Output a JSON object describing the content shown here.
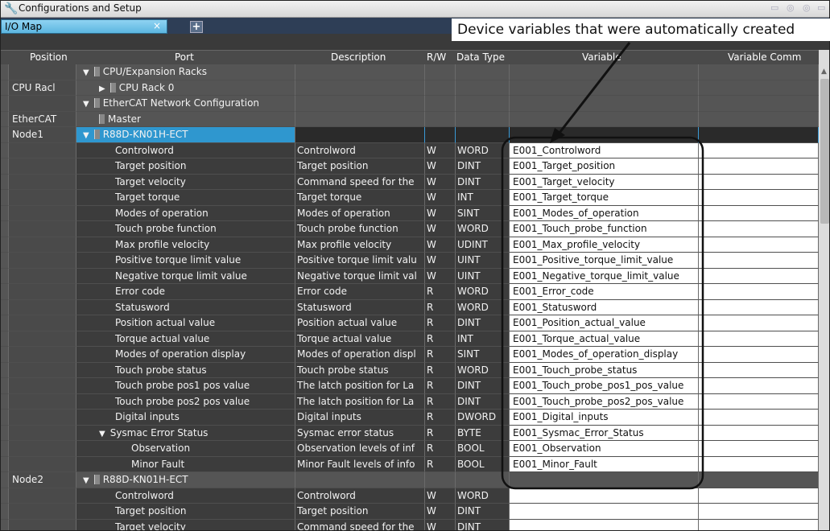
{
  "window": {
    "title": "Configurations and Setup"
  },
  "tab": {
    "label": "I/O Map",
    "close": "×",
    "add": "+"
  },
  "callout": "Device variables that were automatically created",
  "columns": [
    "Position",
    "Port",
    "Description",
    "R/W",
    "Data Type",
    "Variable",
    "Variable Comm"
  ],
  "rows": [
    {
      "pos": "",
      "indent": 0,
      "exp": "▼",
      "icon": "rack",
      "port": "CPU/Expansion Racks",
      "desc": "",
      "rw": "",
      "type": "",
      "var": "",
      "kind": "group"
    },
    {
      "pos": "CPU Racl",
      "indent": 1,
      "exp": "▶",
      "icon": "rack",
      "port": "CPU Rack 0",
      "desc": "",
      "rw": "",
      "type": "",
      "var": "",
      "kind": "group"
    },
    {
      "pos": "",
      "indent": 0,
      "exp": "▼",
      "icon": "net",
      "port": "EtherCAT Network Configuration",
      "desc": "",
      "rw": "",
      "type": "",
      "var": "",
      "kind": "group"
    },
    {
      "pos": "EtherCAT",
      "indent": 1,
      "exp": "",
      "icon": "dev",
      "port": "Master",
      "desc": "",
      "rw": "",
      "type": "",
      "var": "",
      "kind": "group"
    },
    {
      "pos": "Node1",
      "indent": 0,
      "exp": "▼",
      "icon": "dev",
      "port": "R88D-KN01H-ECT",
      "desc": "",
      "rw": "",
      "type": "",
      "var": "",
      "kind": "sel"
    },
    {
      "pos": "",
      "indent": 2,
      "exp": "",
      "icon": "",
      "port": "Controlword",
      "desc": "Controlword",
      "rw": "W",
      "type": "WORD",
      "var": "E001_Controlword",
      "kind": "white"
    },
    {
      "pos": "",
      "indent": 2,
      "exp": "",
      "icon": "",
      "port": "Target position",
      "desc": "Target position",
      "rw": "W",
      "type": "DINT",
      "var": "E001_Target_position",
      "kind": "white"
    },
    {
      "pos": "",
      "indent": 2,
      "exp": "",
      "icon": "",
      "port": "Target velocity",
      "desc": "Command speed for the",
      "rw": "W",
      "type": "DINT",
      "var": "E001_Target_velocity",
      "kind": "white"
    },
    {
      "pos": "",
      "indent": 2,
      "exp": "",
      "icon": "",
      "port": "Target torque",
      "desc": "Target torque",
      "rw": "W",
      "type": "INT",
      "var": "E001_Target_torque",
      "kind": "white"
    },
    {
      "pos": "",
      "indent": 2,
      "exp": "",
      "icon": "",
      "port": "Modes of operation",
      "desc": "Modes of operation",
      "rw": "W",
      "type": "SINT",
      "var": "E001_Modes_of_operation",
      "kind": "white"
    },
    {
      "pos": "",
      "indent": 2,
      "exp": "",
      "icon": "",
      "port": "Touch probe function",
      "desc": "Touch probe function",
      "rw": "W",
      "type": "WORD",
      "var": "E001_Touch_probe_function",
      "kind": "white"
    },
    {
      "pos": "",
      "indent": 2,
      "exp": "",
      "icon": "",
      "port": "Max profile velocity",
      "desc": "Max profile velocity",
      "rw": "W",
      "type": "UDINT",
      "var": "E001_Max_profile_velocity",
      "kind": "white"
    },
    {
      "pos": "",
      "indent": 2,
      "exp": "",
      "icon": "",
      "port": "Positive torque limit value",
      "desc": "Positive torque limit valu",
      "rw": "W",
      "type": "UINT",
      "var": "E001_Positive_torque_limit_value",
      "kind": "white"
    },
    {
      "pos": "",
      "indent": 2,
      "exp": "",
      "icon": "",
      "port": "Negative torque limit value",
      "desc": "Negative torque limit val",
      "rw": "W",
      "type": "UINT",
      "var": "E001_Negative_torque_limit_value",
      "kind": "white"
    },
    {
      "pos": "",
      "indent": 2,
      "exp": "",
      "icon": "",
      "port": "Error code",
      "desc": "Error code",
      "rw": "R",
      "type": "WORD",
      "var": "E001_Error_code",
      "kind": "white"
    },
    {
      "pos": "",
      "indent": 2,
      "exp": "",
      "icon": "",
      "port": "Statusword",
      "desc": "Statusword",
      "rw": "R",
      "type": "WORD",
      "var": "E001_Statusword",
      "kind": "white"
    },
    {
      "pos": "",
      "indent": 2,
      "exp": "",
      "icon": "",
      "port": "Position actual value",
      "desc": "Position actual value",
      "rw": "R",
      "type": "DINT",
      "var": "E001_Position_actual_value",
      "kind": "white"
    },
    {
      "pos": "",
      "indent": 2,
      "exp": "",
      "icon": "",
      "port": "Torque actual value",
      "desc": "Torque actual value",
      "rw": "R",
      "type": "INT",
      "var": "E001_Torque_actual_value",
      "kind": "white"
    },
    {
      "pos": "",
      "indent": 2,
      "exp": "",
      "icon": "",
      "port": "Modes of operation display",
      "desc": "Modes of operation displ",
      "rw": "R",
      "type": "SINT",
      "var": "E001_Modes_of_operation_display",
      "kind": "white"
    },
    {
      "pos": "",
      "indent": 2,
      "exp": "",
      "icon": "",
      "port": "Touch probe status",
      "desc": "Touch probe status",
      "rw": "R",
      "type": "WORD",
      "var": "E001_Touch_probe_status",
      "kind": "white"
    },
    {
      "pos": "",
      "indent": 2,
      "exp": "",
      "icon": "",
      "port": "Touch probe pos1 pos value",
      "desc": "The latch position for La",
      "rw": "R",
      "type": "DINT",
      "var": "E001_Touch_probe_pos1_pos_value",
      "kind": "white"
    },
    {
      "pos": "",
      "indent": 2,
      "exp": "",
      "icon": "",
      "port": "Touch probe pos2 pos value",
      "desc": "The latch position for La",
      "rw": "R",
      "type": "DINT",
      "var": "E001_Touch_probe_pos2_pos_value",
      "kind": "white"
    },
    {
      "pos": "",
      "indent": 2,
      "exp": "",
      "icon": "",
      "port": "Digital inputs",
      "desc": "Digital inputs",
      "rw": "R",
      "type": "DWORD",
      "var": "E001_Digital_inputs",
      "kind": "white"
    },
    {
      "pos": "",
      "indent": 1,
      "exp": "▼",
      "icon": "",
      "port": "Sysmac Error Status",
      "desc": "Sysmac error status",
      "rw": "R",
      "type": "BYTE",
      "var": "E001_Sysmac_Error_Status",
      "kind": "white"
    },
    {
      "pos": "",
      "indent": 3,
      "exp": "",
      "icon": "",
      "port": "Observation",
      "desc": "Observation levels of inf",
      "rw": "R",
      "type": "BOOL",
      "var": "E001_Observation",
      "kind": "white"
    },
    {
      "pos": "",
      "indent": 3,
      "exp": "",
      "icon": "",
      "port": "Minor Fault",
      "desc": "Minor Fault levels of info",
      "rw": "R",
      "type": "BOOL",
      "var": "E001_Minor_Fault",
      "kind": "white"
    },
    {
      "pos": "Node2",
      "indent": 0,
      "exp": "▼",
      "icon": "dev",
      "port": "R88D-KN01H-ECT",
      "desc": "",
      "rw": "",
      "type": "",
      "var": "",
      "kind": "group"
    },
    {
      "pos": "",
      "indent": 2,
      "exp": "",
      "icon": "",
      "port": "Controlword",
      "desc": "Controlword",
      "rw": "W",
      "type": "WORD",
      "var": "",
      "kind": "white"
    },
    {
      "pos": "",
      "indent": 2,
      "exp": "",
      "icon": "",
      "port": "Target position",
      "desc": "Target position",
      "rw": "W",
      "type": "DINT",
      "var": "",
      "kind": "white"
    },
    {
      "pos": "",
      "indent": 2,
      "exp": "",
      "icon": "",
      "port": "Target velocity",
      "desc": "Command speed for the",
      "rw": "W",
      "type": "DINT",
      "var": "",
      "kind": "white"
    }
  ]
}
